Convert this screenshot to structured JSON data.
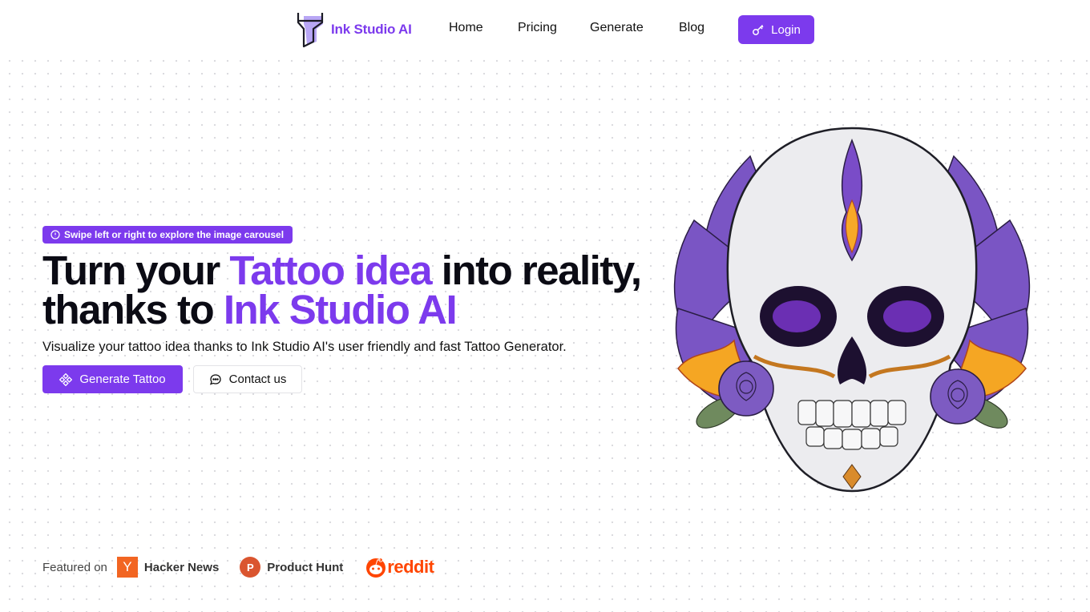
{
  "nav": {
    "brand": "Ink Studio AI",
    "links": [
      {
        "label": "Home"
      },
      {
        "label": "Pricing"
      },
      {
        "label": "Generate"
      },
      {
        "label": "Blog"
      }
    ],
    "login_label": "Login"
  },
  "hero": {
    "hint_badge": "Swipe left or right to explore the image carousel",
    "headline": {
      "part1": "Turn your ",
      "accent1": "Tattoo idea",
      "part2": " into reality, thanks to ",
      "accent2": "Ink Studio AI"
    },
    "subtitle": "Visualize your tattoo idea thanks to Ink Studio AI's user friendly and fast Tattoo Generator.",
    "primary_button": "Generate Tattoo",
    "secondary_button": "Contact us",
    "image_alt": "Purple sugar skull tattoo design with roses, feathers and flames"
  },
  "featured": {
    "label": "Featured on",
    "items": [
      {
        "name": "Hacker News",
        "logo_text": "Y"
      },
      {
        "name": "Product Hunt",
        "logo_text": "P"
      },
      {
        "name": "reddit"
      }
    ]
  },
  "colors": {
    "accent": "#7c3aed",
    "hacker_news": "#f26522",
    "product_hunt": "#da552f",
    "reddit": "#ff4500"
  }
}
